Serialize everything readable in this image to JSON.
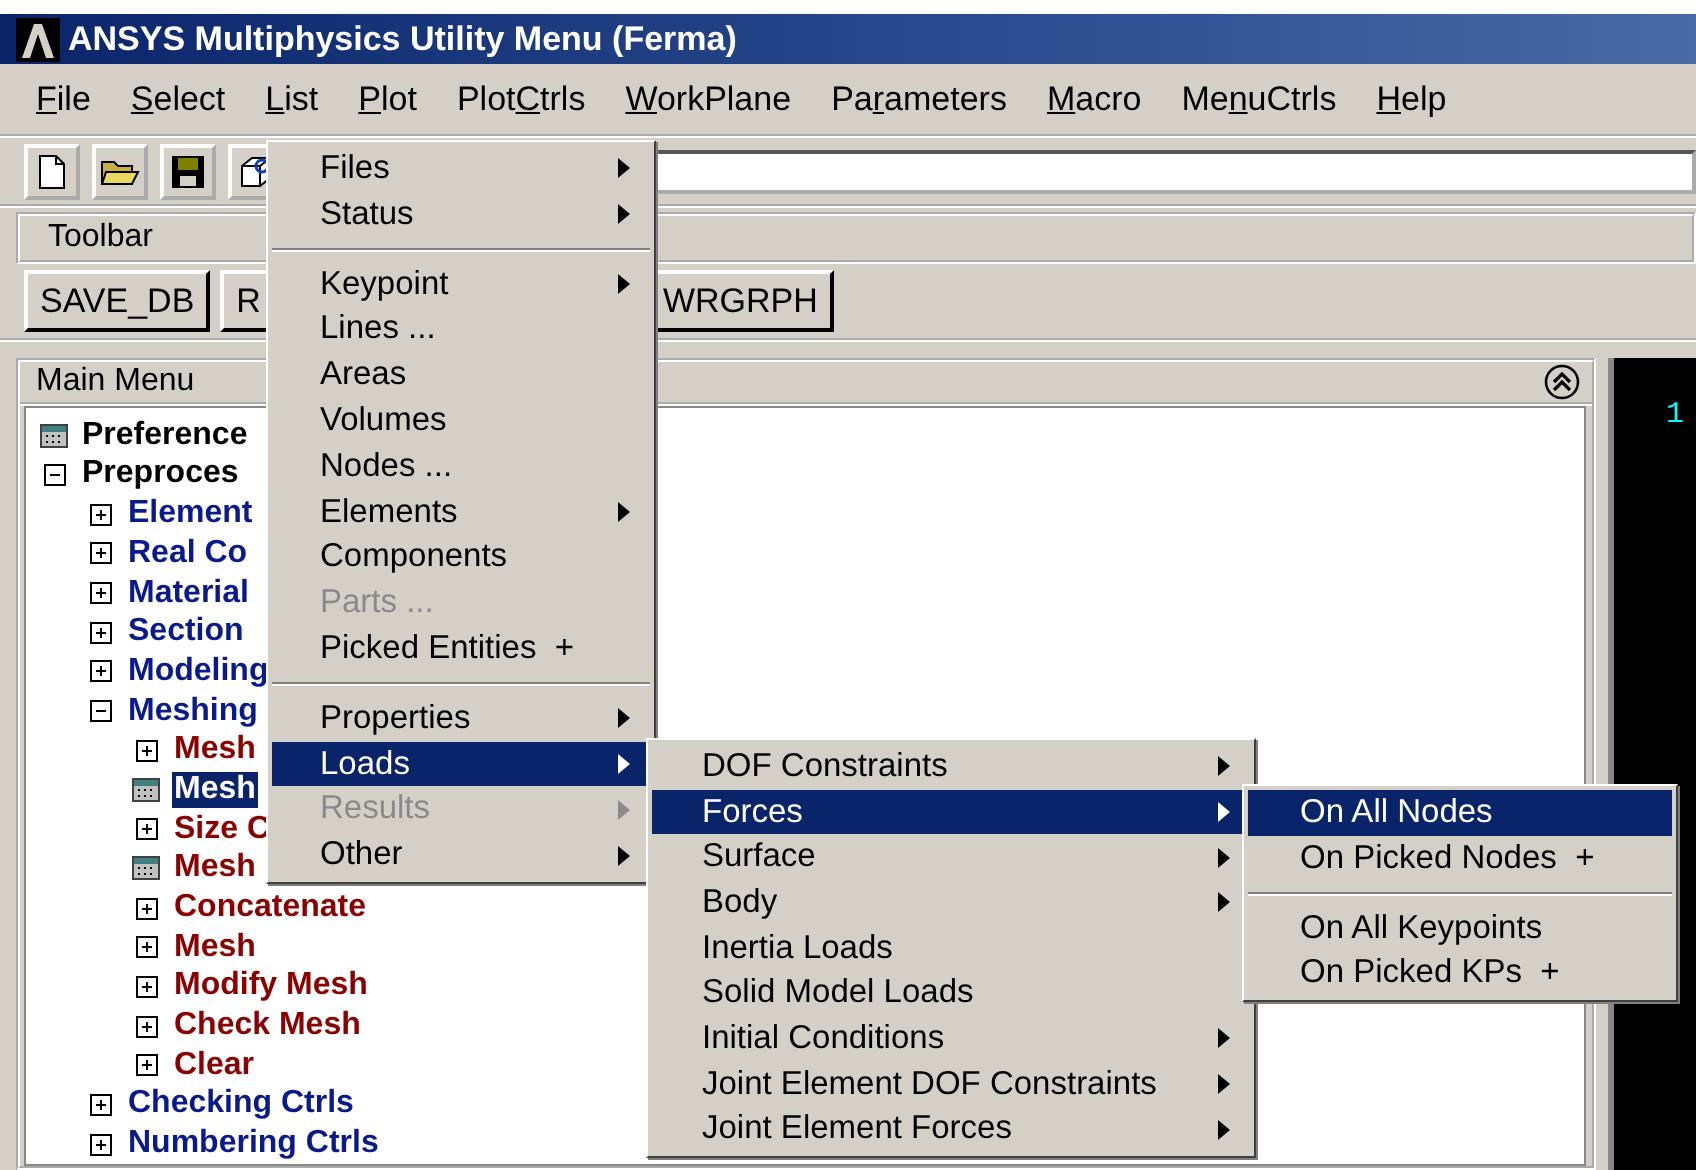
{
  "window": {
    "title": "ANSYS Multiphysics Utility Menu (Ferma)"
  },
  "menubar": [
    {
      "key": "F",
      "post": "ile"
    },
    {
      "key": "S",
      "post": "elect"
    },
    {
      "key": "L",
      "post": "ist"
    },
    {
      "key": "P",
      "post": "lot"
    },
    {
      "pre": "Plot",
      "key": "C",
      "post": "trls"
    },
    {
      "key": "W",
      "post": "orkPlane"
    },
    {
      "pre": "Pa",
      "key": "r",
      "post": "ameters"
    },
    {
      "key": "M",
      "post": "acro"
    },
    {
      "pre": "Me",
      "key": "n",
      "post": "uCtrls"
    },
    {
      "key": "H",
      "post": "elp"
    }
  ],
  "toolbar_label": "Toolbar",
  "toolbar_buttons": [
    "SAVE_DB",
    "R",
    "WRGRPH"
  ],
  "main_menu": {
    "title": "Main Menu",
    "tree": [
      {
        "label": "Preference",
        "kind": "doc",
        "selected": false
      },
      {
        "label": "Preproces",
        "kind": "folder",
        "expanded": true,
        "selected": false,
        "children": [
          {
            "label": "Element",
            "kind": "folder",
            "expanded": false,
            "selected": false
          },
          {
            "label": "Real Co",
            "kind": "folder",
            "expanded": false,
            "selected": false
          },
          {
            "label": "Material",
            "kind": "folder",
            "expanded": false,
            "selected": false
          },
          {
            "label": "Section",
            "kind": "folder",
            "expanded": false,
            "selected": false
          },
          {
            "label": "Modeling",
            "kind": "folder",
            "expanded": false,
            "selected": false
          },
          {
            "label": "Meshing",
            "kind": "folder",
            "expanded": true,
            "selected": false,
            "children": [
              {
                "label": "Mesh",
                "kind": "folder",
                "expanded": false,
                "selected": false
              },
              {
                "label": "Mesh",
                "kind": "doc",
                "selected": true
              },
              {
                "label": "Size C",
                "kind": "folder",
                "expanded": false,
                "selected": false
              },
              {
                "label": "Mesh",
                "kind": "doc",
                "selected": false
              },
              {
                "label": "Concatenate",
                "kind": "folder",
                "expanded": false,
                "selected": false
              },
              {
                "label": "Mesh",
                "kind": "folder",
                "expanded": false,
                "selected": false
              },
              {
                "label": "Modify Mesh",
                "kind": "folder",
                "expanded": false,
                "selected": false
              },
              {
                "label": "Check Mesh",
                "kind": "folder",
                "expanded": false,
                "selected": false
              },
              {
                "label": "Clear",
                "kind": "folder",
                "expanded": false,
                "selected": false
              }
            ]
          },
          {
            "label": "Checking Ctrls",
            "kind": "folder",
            "expanded": false,
            "selected": false
          },
          {
            "label": "Numbering Ctrls",
            "kind": "folder",
            "expanded": false,
            "selected": false
          }
        ]
      }
    ]
  },
  "graphics": {
    "label": "1"
  },
  "list_menu": [
    [
      {
        "label": "Files",
        "submenu": true,
        "disabled": false,
        "selected": false
      },
      {
        "label": "Status",
        "submenu": true,
        "disabled": false,
        "selected": false
      }
    ],
    [
      {
        "label": "Keypoint",
        "submenu": true,
        "disabled": false,
        "selected": false
      },
      {
        "label": "Lines ...",
        "submenu": false,
        "disabled": false,
        "selected": false
      },
      {
        "label": "Areas",
        "submenu": false,
        "disabled": false,
        "selected": false
      },
      {
        "label": "Volumes",
        "submenu": false,
        "disabled": false,
        "selected": false
      },
      {
        "label": "Nodes ...",
        "submenu": false,
        "disabled": false,
        "selected": false
      },
      {
        "label": "Elements",
        "submenu": true,
        "disabled": false,
        "selected": false
      },
      {
        "label": "Components",
        "submenu": false,
        "disabled": false,
        "selected": false
      },
      {
        "label": "Parts ...",
        "submenu": false,
        "disabled": true,
        "selected": false
      },
      {
        "label": "Picked Entities  +",
        "submenu": false,
        "disabled": false,
        "selected": false
      }
    ],
    [
      {
        "label": "Properties",
        "submenu": true,
        "disabled": false,
        "selected": false
      },
      {
        "label": "Loads",
        "submenu": true,
        "disabled": false,
        "selected": true
      },
      {
        "label": "Results",
        "submenu": true,
        "disabled": true,
        "selected": false
      },
      {
        "label": "Other",
        "submenu": true,
        "disabled": false,
        "selected": false
      }
    ]
  ],
  "loads_menu": [
    [
      {
        "label": "DOF Constraints",
        "submenu": true,
        "disabled": false,
        "selected": false
      },
      {
        "label": "Forces",
        "submenu": true,
        "disabled": false,
        "selected": true
      },
      {
        "label": "Surface",
        "submenu": true,
        "disabled": false,
        "selected": false
      },
      {
        "label": "Body",
        "submenu": true,
        "disabled": false,
        "selected": false
      },
      {
        "label": "Inertia Loads",
        "submenu": false,
        "disabled": false,
        "selected": false
      },
      {
        "label": "Solid Model Loads",
        "submenu": false,
        "disabled": false,
        "selected": false
      },
      {
        "label": "Initial Conditions",
        "submenu": true,
        "disabled": false,
        "selected": false
      },
      {
        "label": "Joint Element DOF Constraints",
        "submenu": true,
        "disabled": false,
        "selected": false
      },
      {
        "label": "Joint Element Forces",
        "submenu": true,
        "disabled": false,
        "selected": false
      }
    ]
  ],
  "forces_menu": [
    [
      {
        "label": "On All Nodes",
        "submenu": false,
        "disabled": false,
        "selected": true
      },
      {
        "label": "On Picked Nodes  +",
        "submenu": false,
        "disabled": false,
        "selected": false
      }
    ],
    [
      {
        "label": "On All Keypoints",
        "submenu": false,
        "disabled": false,
        "selected": false
      },
      {
        "label": "On Picked KPs  +",
        "submenu": false,
        "disabled": false,
        "selected": false
      }
    ]
  ]
}
